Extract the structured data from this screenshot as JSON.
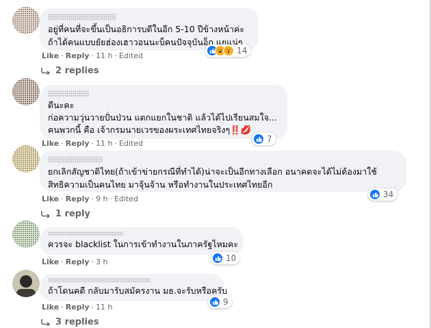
{
  "comments": [
    {
      "author": "",
      "lines": [
        "อยู่ที่คนที่จะขึ้นเป็นอธิการบดีในอีก 5-10 ปีข้างหน้าค่ะ",
        "ถ้าได้คนแบบยัยฮ่องเฮาวอนนะบ็คนปัจจุบันอ็ก แยแน่ๆ"
      ],
      "actions": {
        "like": "Like",
        "reply": "Reply",
        "time": "11 h",
        "edited": "Edited"
      },
      "reactions": {
        "count": "14",
        "icons": [
          "like-icon",
          "haha-icon",
          "wow-icon"
        ]
      },
      "replies": "2 replies"
    },
    {
      "author": "",
      "lines": [
        "ดีนะคะ",
        "ก่อความวุ่นวายปั่นป่วน แตกแยกในชาติ แล้วได้ไปเรียนสมใจ...",
        "คนพวกนี้ คือ เจ้ากรมนายเวรของผระเทศไทยจริงๆ‼️💋"
      ],
      "actions": {
        "like": "Like",
        "reply": "Reply",
        "time": "11 h",
        "edited": "Edited"
      },
      "reactions": {
        "count": "7",
        "icons": [
          "like-icon"
        ]
      },
      "replies": ""
    },
    {
      "author": "",
      "lines": [
        "ยกเลิกสัญชาติไทย(ถ้าเข้าข่ายกรณีที่ทำได้)น่าจะเป็นอีกทางเลือก อนาคตจะได้ไม่ต้องมาใช้",
        "สิทธิความเป็นคนไทย มาจุ้นจ้าน หรือทำงานในประเทศไทยอีก"
      ],
      "actions": {
        "like": "Like",
        "reply": "Reply",
        "time": "9 h",
        "edited": "Edited"
      },
      "reactions": {
        "count": "34",
        "icons": [
          "like-icon"
        ]
      },
      "replies": "1 reply"
    },
    {
      "author": "",
      "lines": [
        "ควรจะ blacklist ในการเข้าทำงานในภาครัฐไหมคะ"
      ],
      "actions": {
        "like": "Like",
        "reply": "Reply",
        "time": "3 h",
        "edited": ""
      },
      "reactions": {
        "count": "10",
        "icons": [
          "like-icon"
        ]
      },
      "replies": ""
    },
    {
      "author": "",
      "lines": [
        "ถ้าโดนคดี กลับมารับสมัครงาน มธ.จะรับหรือครับ"
      ],
      "actions": {
        "like": "Like",
        "reply": "Reply",
        "time": "11 h",
        "edited": ""
      },
      "reactions": {
        "count": "9",
        "icons": [
          "like-icon"
        ]
      },
      "replies": "3 replies"
    }
  ],
  "colors": {
    "bubble": "#f0f2f5",
    "like_blue": "#1877f2",
    "meta_gray": "#65676b"
  }
}
